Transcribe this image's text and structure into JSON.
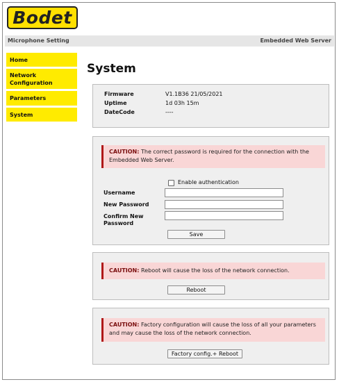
{
  "brand": {
    "logo_text": "Bodet"
  },
  "header": {
    "left": "Microphone Setting",
    "right": "Embedded Web Server"
  },
  "nav": {
    "items": [
      {
        "label": "Home"
      },
      {
        "label": "Network Configuration"
      },
      {
        "label": "Parameters"
      },
      {
        "label": "System"
      }
    ]
  },
  "page": {
    "title": "System"
  },
  "info": {
    "firmware_label": "Firmware",
    "firmware_value": "V1.1B36 21/05/2021",
    "uptime_label": "Uptime",
    "uptime_value": "1d 03h 15m",
    "datecode_label": "DateCode",
    "datecode_value": "----"
  },
  "auth": {
    "caution_title": "CAUTION:",
    "caution_text": "The correct password is required for the connection with the Embedded Web Server.",
    "enable_label": "Enable authentication",
    "username_label": "Username",
    "new_password_label": "New Password",
    "confirm_password_label": "Confirm New Password",
    "save_label": "Save"
  },
  "reboot": {
    "caution_title": "CAUTION:",
    "caution_text": "Reboot will cause the loss of the network connection.",
    "button_label": "Reboot"
  },
  "factory": {
    "caution_title": "CAUTION:",
    "caution_text": "Factory configuration will cause the loss of all your parameters and may cause the loss of the network connection.",
    "button_label": "Factory config.+ Reboot"
  },
  "colors": {
    "accent_yellow": "#ffeb00",
    "caution_bg": "#f9d6d6",
    "caution_border": "#b01818"
  }
}
